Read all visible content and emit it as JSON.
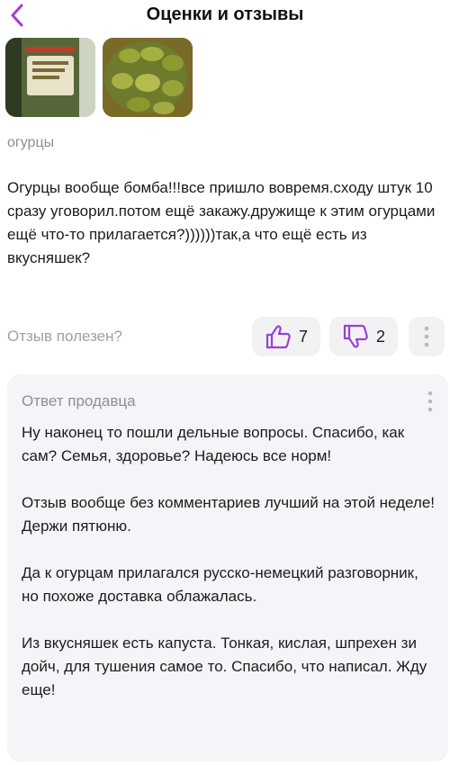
{
  "header": {
    "title": "Оценки и отзывы"
  },
  "review": {
    "product_name": "огурцы",
    "text": "Огурцы вообще бомба!!!все пришло вовремя.сходу штук 10 сразу уговорил.потом ещё закажу.дружище к этим огурцами ещё что-то прилагается?))))))так,а что ещё есть из вкусняшек?",
    "photos": [
      "pickle-jar-photo",
      "pickles-bowl-photo"
    ]
  },
  "helpful": {
    "label": "Отзыв полезен?",
    "likes": "7",
    "dislikes": "2"
  },
  "seller_reply": {
    "title": "Ответ продавца",
    "paragraphs": [
      "Ну наконец то пошли дельные вопросы. Спасибо, как сам? Семья, здоровье? Надеюсь все норм!",
      "Отзыв вообще без комментариев лучший на этой неделе!  Держи пятюню.",
      "Да к огурцам прилагался русско-немецкий разговорник, но похоже доставка облажалась.",
      "Из вкусняшек есть капуста.  Тонкая, кислая, шпрехен зи дойч, для тушения самое то. Спасибо, что написал. Жду еще!"
    ]
  },
  "colors": {
    "accent": "#9b3fd6",
    "muted_text": "#8e8e93",
    "card_bg": "#f5f4f8"
  },
  "icons": {
    "back": "chevron-left-icon",
    "like": "thumbs-up-icon",
    "dislike": "thumbs-down-icon",
    "more": "more-vertical-icon"
  }
}
